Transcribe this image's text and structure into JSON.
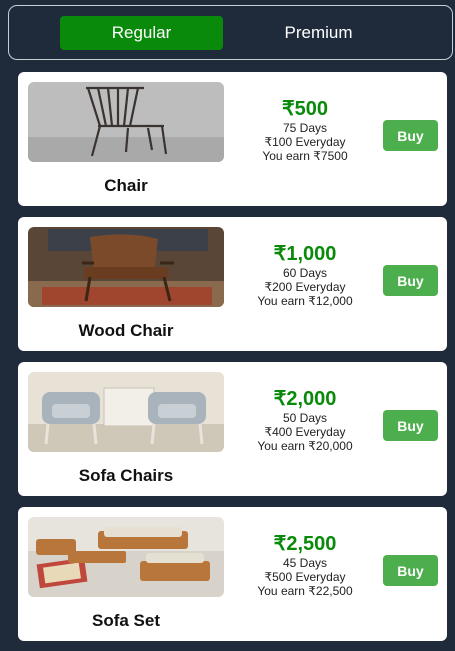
{
  "tabs": [
    {
      "label": "Regular",
      "active": true
    },
    {
      "label": "Premium",
      "active": false
    }
  ],
  "products": [
    {
      "name": "Chair",
      "price": "₹500",
      "days": "75 Days",
      "daily": "₹100 Everyday",
      "earn": "You earn ₹7500",
      "buy_label": "Buy",
      "image_icon": "wooden-chair"
    },
    {
      "name": "Wood Chair",
      "price": "₹1,000",
      "days": "60 Days",
      "daily": "₹200 Everyday",
      "earn": "You earn ₹12,000",
      "buy_label": "Buy",
      "image_icon": "leather-wood-chair"
    },
    {
      "name": "Sofa Chairs",
      "price": "₹2,000",
      "days": "50 Days",
      "daily": "₹400 Everyday",
      "earn": "You earn ₹20,000",
      "buy_label": "Buy",
      "image_icon": "sofa-chairs"
    },
    {
      "name": "Sofa Set",
      "price": "₹2,500",
      "days": "45 Days",
      "daily": "₹500 Everyday",
      "earn": "You earn ₹22,500",
      "buy_label": "Buy",
      "image_icon": "sofa-set"
    }
  ],
  "colors": {
    "accent": "#0a8a0a",
    "buy": "#4cae4c",
    "background": "#1f2a3b"
  }
}
